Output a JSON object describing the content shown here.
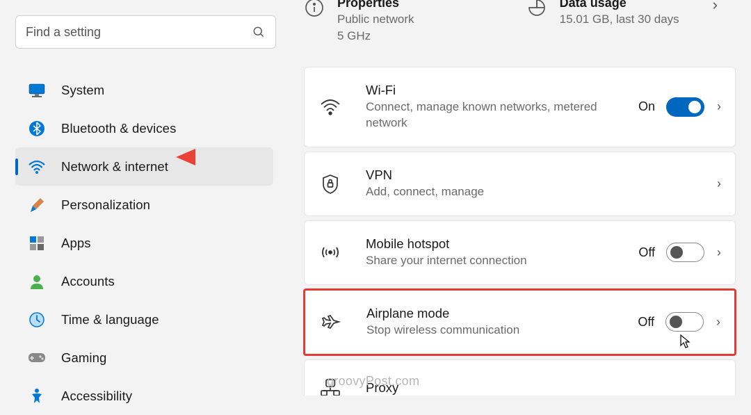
{
  "search": {
    "placeholder": "Find a setting"
  },
  "sidebar": {
    "items": [
      {
        "label": "System",
        "icon": "system"
      },
      {
        "label": "Bluetooth & devices",
        "icon": "bluetooth"
      },
      {
        "label": "Network & internet",
        "icon": "network",
        "selected": true
      },
      {
        "label": "Personalization",
        "icon": "brush"
      },
      {
        "label": "Apps",
        "icon": "apps"
      },
      {
        "label": "Accounts",
        "icon": "accounts"
      },
      {
        "label": "Time & language",
        "icon": "clock"
      },
      {
        "label": "Gaming",
        "icon": "gamepad"
      },
      {
        "label": "Accessibility",
        "icon": "accessibility"
      }
    ]
  },
  "top": {
    "properties": {
      "title": "Properties",
      "sub1": "Public network",
      "sub2": "5 GHz"
    },
    "usage": {
      "title": "Data usage",
      "sub": "15.01 GB, last 30 days"
    }
  },
  "cards": {
    "wifi": {
      "title": "Wi-Fi",
      "sub": "Connect, manage known networks, metered network",
      "state": "On",
      "on": true
    },
    "vpn": {
      "title": "VPN",
      "sub": "Add, connect, manage"
    },
    "hotspot": {
      "title": "Mobile hotspot",
      "sub": "Share your internet connection",
      "state": "Off",
      "on": false
    },
    "airplane": {
      "title": "Airplane mode",
      "sub": "Stop wireless communication",
      "state": "Off",
      "on": false
    },
    "proxy": {
      "title": "Proxy"
    }
  },
  "watermark": "groovyPost.com"
}
